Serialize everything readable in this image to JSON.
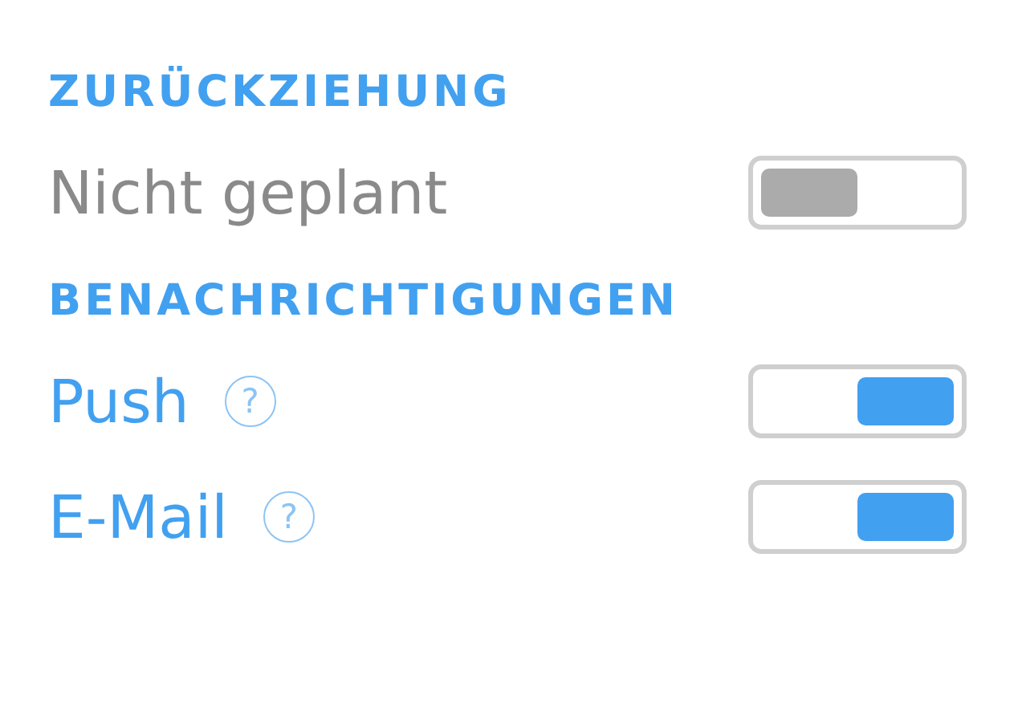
{
  "sections": [
    {
      "title": "ZURÜCKZIEHUNG",
      "rows": [
        {
          "label": "Nicht geplant",
          "on": false
        }
      ]
    },
    {
      "title": "BENACHRICHTIGUNGEN",
      "rows": [
        {
          "label": "Push",
          "help": "?",
          "on": true
        },
        {
          "label": "E-Mail",
          "help": "?",
          "on": true
        }
      ]
    }
  ]
}
